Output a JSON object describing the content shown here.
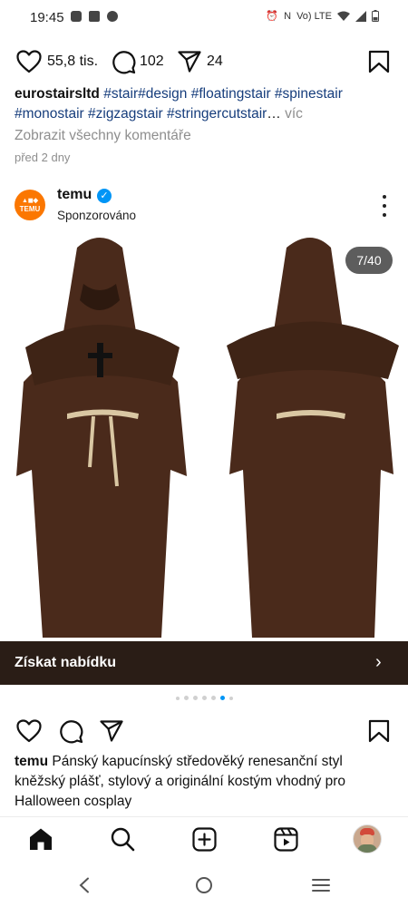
{
  "status_bar": {
    "time": "19:45",
    "right_text": "Vo) LTE"
  },
  "top_post": {
    "likes": "55,8 tis.",
    "comments": "102",
    "shares": "24",
    "username": "eurostairsltd",
    "hashtags": [
      "#stair",
      "#design",
      "#floatingstair",
      "#spinestair",
      "#monostair",
      "#zigzagstair",
      "#stringercutstair"
    ],
    "ellipsis": "…",
    "more_label": "víc",
    "view_comments": "Zobrazit všechny komentáře",
    "time_ago": "před 2 dny"
  },
  "ad_post": {
    "avatar_text": "TEMU",
    "username": "temu",
    "sponsored_label": "Sponzorováno",
    "counter": "7/40",
    "cta_label": "Získat nabídku",
    "caption_user": "temu",
    "caption_text": "Pánský kapucínský středověký renesanční styl kněžský plášť, stylový a originální kostým vhodný pro Halloween cosplay",
    "active_slide_dot": 5,
    "colors": {
      "cta_bg": "#2a1d16",
      "robe": "#4a2a1b",
      "rope": "#d9c7a3",
      "brand": "#fb7701",
      "verified": "#0095f6"
    }
  },
  "bottom_nav": [
    "home-icon",
    "search-icon",
    "create-icon",
    "reels-icon",
    "profile-avatar"
  ],
  "system_nav": [
    "back-icon",
    "home-circle-icon",
    "recents-icon"
  ]
}
